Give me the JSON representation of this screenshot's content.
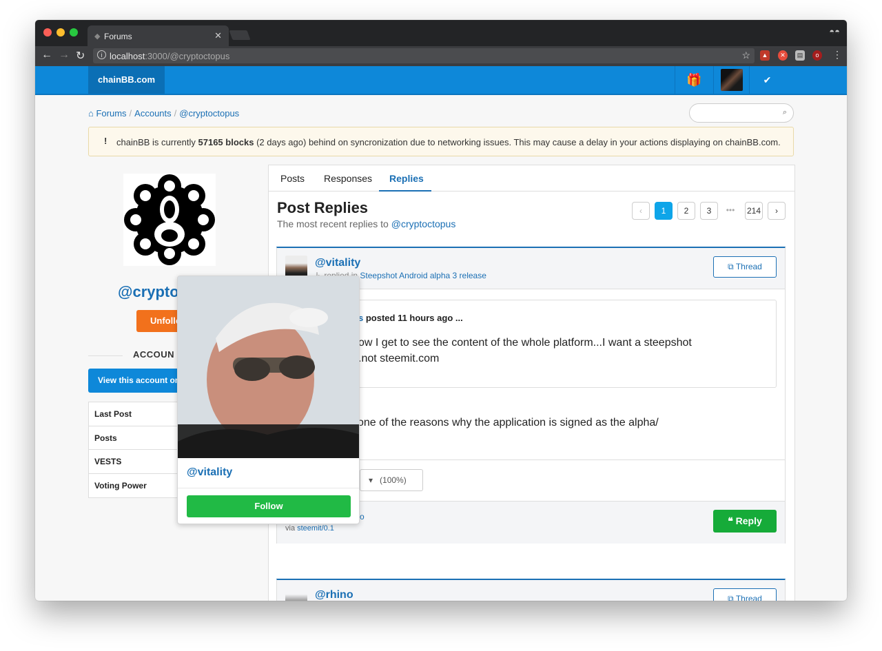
{
  "browser": {
    "tab_title": "Forums",
    "url_host": "localhost",
    "url_rest": ":3000/@cryptoctopus"
  },
  "site": {
    "brand": "chainBB.com"
  },
  "breadcrumb": {
    "forums": "Forums",
    "accounts": "Accounts",
    "user": "@cryptoctopus"
  },
  "alert": {
    "prefix": "chainBB is currently ",
    "blocks": "57165 blocks",
    "suffix": " (2 days ago) behind on syncronization due to networking issues. This may cause a delay in your actions displaying on chainBB.com."
  },
  "profile": {
    "username": "@cryptoc",
    "unfollow_label": "Unfollo",
    "account_section": "ACCOUN",
    "view_account": "View this account on",
    "stats": [
      "Last Post",
      "Posts",
      "VESTS",
      "Voting Power"
    ]
  },
  "tabs": [
    "Posts",
    "Responses",
    "Replies"
  ],
  "post_replies": {
    "title": "Post Replies",
    "subtitle_prefix": "The most recent replies to ",
    "subtitle_user": "@cryptoctopus"
  },
  "pagination": {
    "prev": "‹",
    "pages": [
      "1",
      "2",
      "3"
    ],
    "ellipsis": "•••",
    "last": "214",
    "next": "›"
  },
  "replies": [
    {
      "author": "@vitality",
      "replied_in_prefix": "↳ replied in ",
      "thread_title": "Steepshot Android alpha 3 release",
      "thread_button": "Thread",
      "quote_author": "s",
      "quote_posted": " posted 11 hours ago ...",
      "quote_line1": "ow I get to see the content of the whole platform...I want a steepshot",
      "quote_line2": ".not steemit.com",
      "body": "one of the reasons why the application is signed as the alpha/",
      "vote_percent": "(100%)",
      "footer_author": "o",
      "via_prefix": "via ",
      "via_app": "steemit/0.1",
      "reply_button": "Reply"
    },
    {
      "author": "@rhino",
      "thread_button": "Thread"
    }
  ],
  "popup": {
    "username": "@vitality",
    "follow_label": "Follow"
  }
}
